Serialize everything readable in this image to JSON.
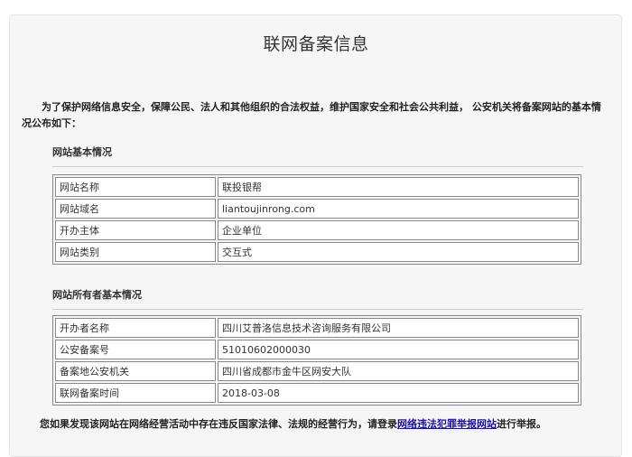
{
  "page": {
    "title": "联网备案信息",
    "intro": "为了保护网络信息安全，保障公民、法人和其他组织的合法权益，维护国家安全和社会公共利益， 公安机关将备案网站的基本情况公布如下："
  },
  "site_info": {
    "title": "网站基本情况",
    "rows": [
      {
        "label": "网站名称",
        "value": "联投银帮"
      },
      {
        "label": "网站域名",
        "value": "liantoujinrong.com"
      },
      {
        "label": "开办主体",
        "value": "企业单位"
      },
      {
        "label": "网站类别",
        "value": "交互式"
      }
    ]
  },
  "owner_info": {
    "title": "网站所有者基本情况",
    "rows": [
      {
        "label": "开办者名称",
        "value": "四川艾普洛信息技术咨询服务有限公司"
      },
      {
        "label": "公安备案号",
        "value": "51010602000030"
      },
      {
        "label": "备案地公安机关",
        "value": "四川省成都市金牛区网安大队"
      },
      {
        "label": "联网备案时间",
        "value": "2018-03-08"
      }
    ]
  },
  "footer": {
    "prefix": "您如果发现该网站在网络经营活动中存在违反国家法律、法规的经营行为，请登录",
    "link_text": "网络违法犯罪举报网站",
    "suffix": "进行举报。"
  }
}
